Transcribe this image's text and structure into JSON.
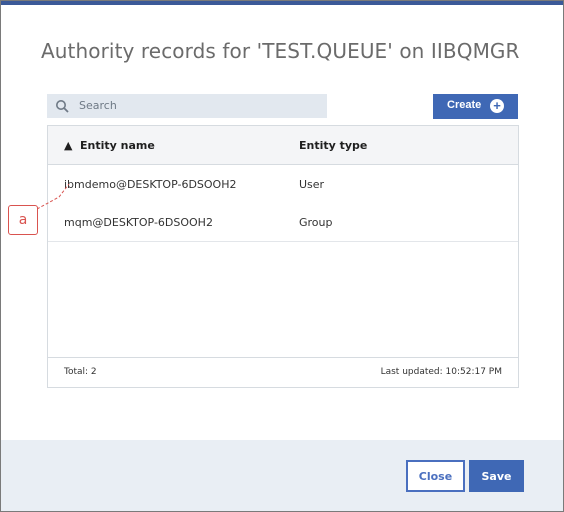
{
  "dialog": {
    "title": "Authority records for 'TEST.QUEUE' on IIBQMGR",
    "accent_color": "#3f68b5"
  },
  "search": {
    "placeholder": "Search",
    "icon": "search-icon"
  },
  "create_button": {
    "label": "Create",
    "icon": "plus-circle-icon"
  },
  "table": {
    "sort_indicator": "▲",
    "columns": [
      "Entity name",
      "Entity type"
    ],
    "rows": [
      {
        "entity_name": "ibmdemo@DESKTOP-6DSOOH2",
        "entity_type": "User"
      },
      {
        "entity_name": "mqm@DESKTOP-6DSOOH2",
        "entity_type": "Group"
      }
    ],
    "total_text": "Total: 2",
    "last_updated_text": "Last updated: 10:52:17 PM"
  },
  "buttons": {
    "close": "Close",
    "save": "Save"
  },
  "annotation": {
    "label": "a",
    "color": "#d9534f"
  }
}
